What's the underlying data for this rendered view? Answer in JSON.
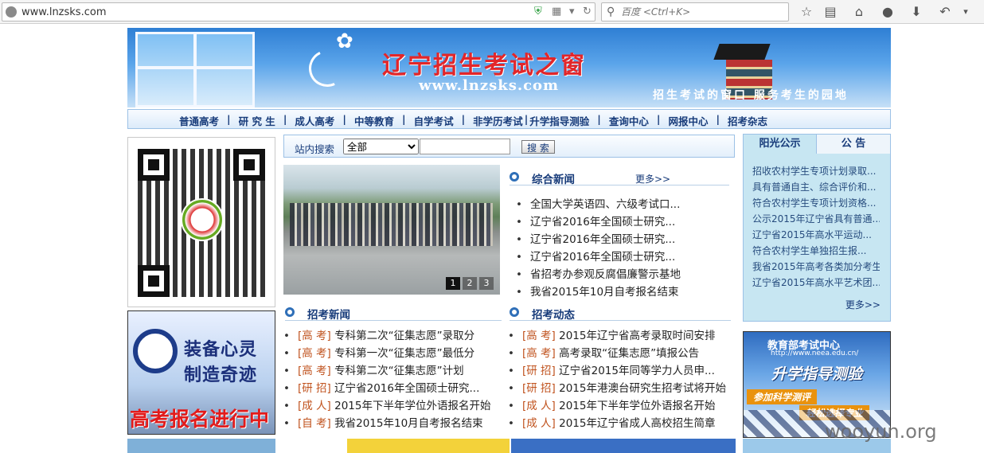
{
  "browser": {
    "url": "www.lnzsks.com",
    "search_placeholder": "百度 <Ctrl+K>"
  },
  "banner": {
    "title": "辽宁招生考试之窗",
    "site": "www.lnzsks.com",
    "slogan": "招生考试的窗口  服务考生的园地"
  },
  "nav": {
    "items": [
      "普通高考",
      "研 究 生",
      "成人高考",
      "中等教育",
      "自学考试",
      "非学历考试",
      "升学指导测验",
      "查询中心",
      "网报中心",
      "招考杂志"
    ]
  },
  "search": {
    "label": "站内搜索",
    "select_value": "全部",
    "button_label": "搜 索"
  },
  "photo": {
    "pages": [
      "1",
      "2",
      "3"
    ]
  },
  "news": {
    "title": "综合新闻",
    "more": "更多>>",
    "items": [
      "全国大学英语四、六级考试口...",
      "辽宁省2016年全国硕士研究...",
      "辽宁省2016年全国硕士研究...",
      "辽宁省2016年全国硕士研究...",
      "省招考办参观反腐倡廉警示基地",
      "我省2015年10月自考报名结束"
    ]
  },
  "admission_news": {
    "title": "招考新闻",
    "items": [
      {
        "tag": "[高 考]",
        "text": "专科第二次“征集志愿”录取分"
      },
      {
        "tag": "[高 考]",
        "text": "专科第一次“征集志愿”最低分"
      },
      {
        "tag": "[高 考]",
        "text": "专科第二次“征集志愿”计划"
      },
      {
        "tag": "[研 招]",
        "text": "辽宁省2016年全国硕士研究..."
      },
      {
        "tag": "[成 人]",
        "text": "2015年下半年学位外语报名开始"
      },
      {
        "tag": "[自 考]",
        "text": "我省2015年10月自考报名结束"
      }
    ]
  },
  "admission_updates": {
    "title": "招考动态",
    "items": [
      {
        "tag": "[高 考]",
        "text": "2015年辽宁省高考录取时间安排"
      },
      {
        "tag": "[高 考]",
        "text": "高考录取“征集志愿”填报公告"
      },
      {
        "tag": "[研 招]",
        "text": "辽宁省2015年同等学力人员申..."
      },
      {
        "tag": "[研 招]",
        "text": "2015年港澳台研究生招考试将开始"
      },
      {
        "tag": "[成 人]",
        "text": "2015年下半年学位外语报名开始"
      },
      {
        "tag": "[成 人]",
        "text": "2015年辽宁省成人高校招生简章"
      }
    ]
  },
  "sidebar": {
    "tab1": "阳光公示",
    "tab2": "公 告",
    "items": [
      "招收农村学生专项计划录取...",
      "具有普通自主、综合评价和...",
      "符合农村学生专项计划资格...",
      "公示2015年辽宁省具有普通...",
      "辽宁省2015年高水平运动...",
      "符合农村学生单独招生报...",
      "我省2015年高考各类加分考生",
      "辽宁省2015年高水平艺术团..."
    ],
    "more": "更多>>"
  },
  "ads": {
    "left_line1": "装备心灵",
    "left_line2": "制造奇迹",
    "left_line3": "高考报名进行中",
    "right_top": "教育部考试中心",
    "right_url": "http://www.neea.edu.cn/",
    "right_big": "升学指导测验",
    "right_badge1": "参加科学测评",
    "right_badge2": "轻松选择专业"
  },
  "watermark": "wooyun.org"
}
